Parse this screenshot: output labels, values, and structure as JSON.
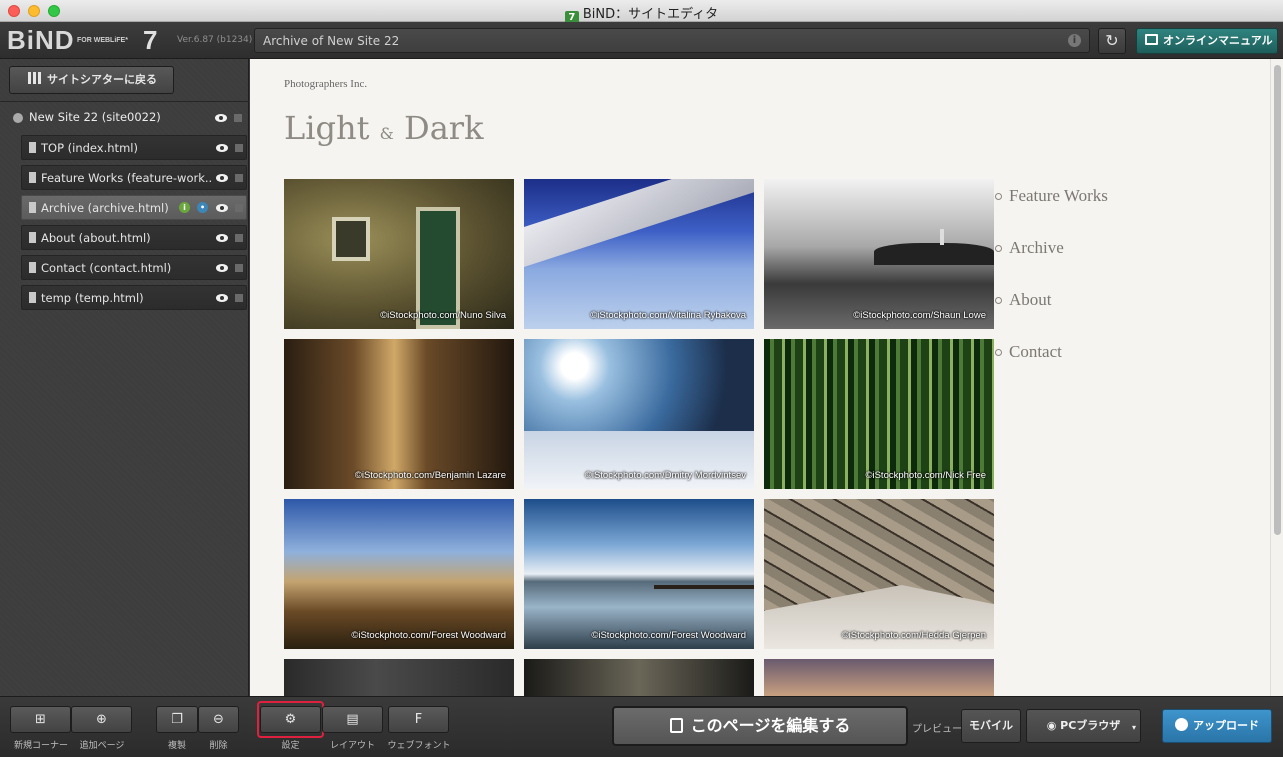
{
  "window": {
    "badge": "7",
    "title": "BiND：サイトエディタ"
  },
  "toolbar": {
    "logo_main": "BiND",
    "logo_sub": "FOR WEBLiFE*",
    "logo_version_num": "7",
    "version": "Ver.6.87 (b1234)",
    "url": "Archive of New Site 22",
    "manual_label": "オンラインマニュアル"
  },
  "sidebar": {
    "back_label": "サイトシアターに戻る",
    "site_label": "New Site 22 (site0022)",
    "pages": [
      {
        "label": "TOP (index.html)"
      },
      {
        "label": "Feature Works (feature-work..."
      },
      {
        "label": "Archive (archive.html)"
      },
      {
        "label": "About (about.html)"
      },
      {
        "label": "Contact (contact.html)"
      },
      {
        "label": "temp (temp.html)"
      }
    ]
  },
  "preview": {
    "company": "Photographers Inc.",
    "title_left": "Light",
    "title_amp": "&",
    "title_right": "Dark",
    "photos": [
      {
        "credit": "©iStockphoto.com/Nuno Silva"
      },
      {
        "credit": "©iStockphoto.com/Vitalina Rybakova"
      },
      {
        "credit": "©iStockphoto.com/Shaun Lowe"
      },
      {
        "credit": "©iStockphoto.com/Benjamin Lazare"
      },
      {
        "credit": "©iStockphoto.com/Dmitry Mordvintsev"
      },
      {
        "credit": "©iStockphoto.com/Nick Free"
      },
      {
        "credit": "©iStockphoto.com/Forest Woodward"
      },
      {
        "credit": "©iStockphoto.com/Forest Woodward"
      },
      {
        "credit": "©iStockphoto.com/Hedda Gjerpen"
      }
    ],
    "nav": [
      "Feature Works",
      "Archive",
      "About",
      "Contact"
    ]
  },
  "bottombar": {
    "new_corner": "新規コーナー",
    "add_page": "追加ページ",
    "duplicate": "複製",
    "delete": "削除",
    "settings": "設定",
    "layout": "レイアウト",
    "webfont": "ウェブフォント",
    "webfont_glyph": "F",
    "edit_page": "このページを編集する",
    "preview_label": "プレビュー",
    "mobile": "モバイル",
    "pc_browser": "PCブラウザ",
    "upload": "アップロード"
  }
}
